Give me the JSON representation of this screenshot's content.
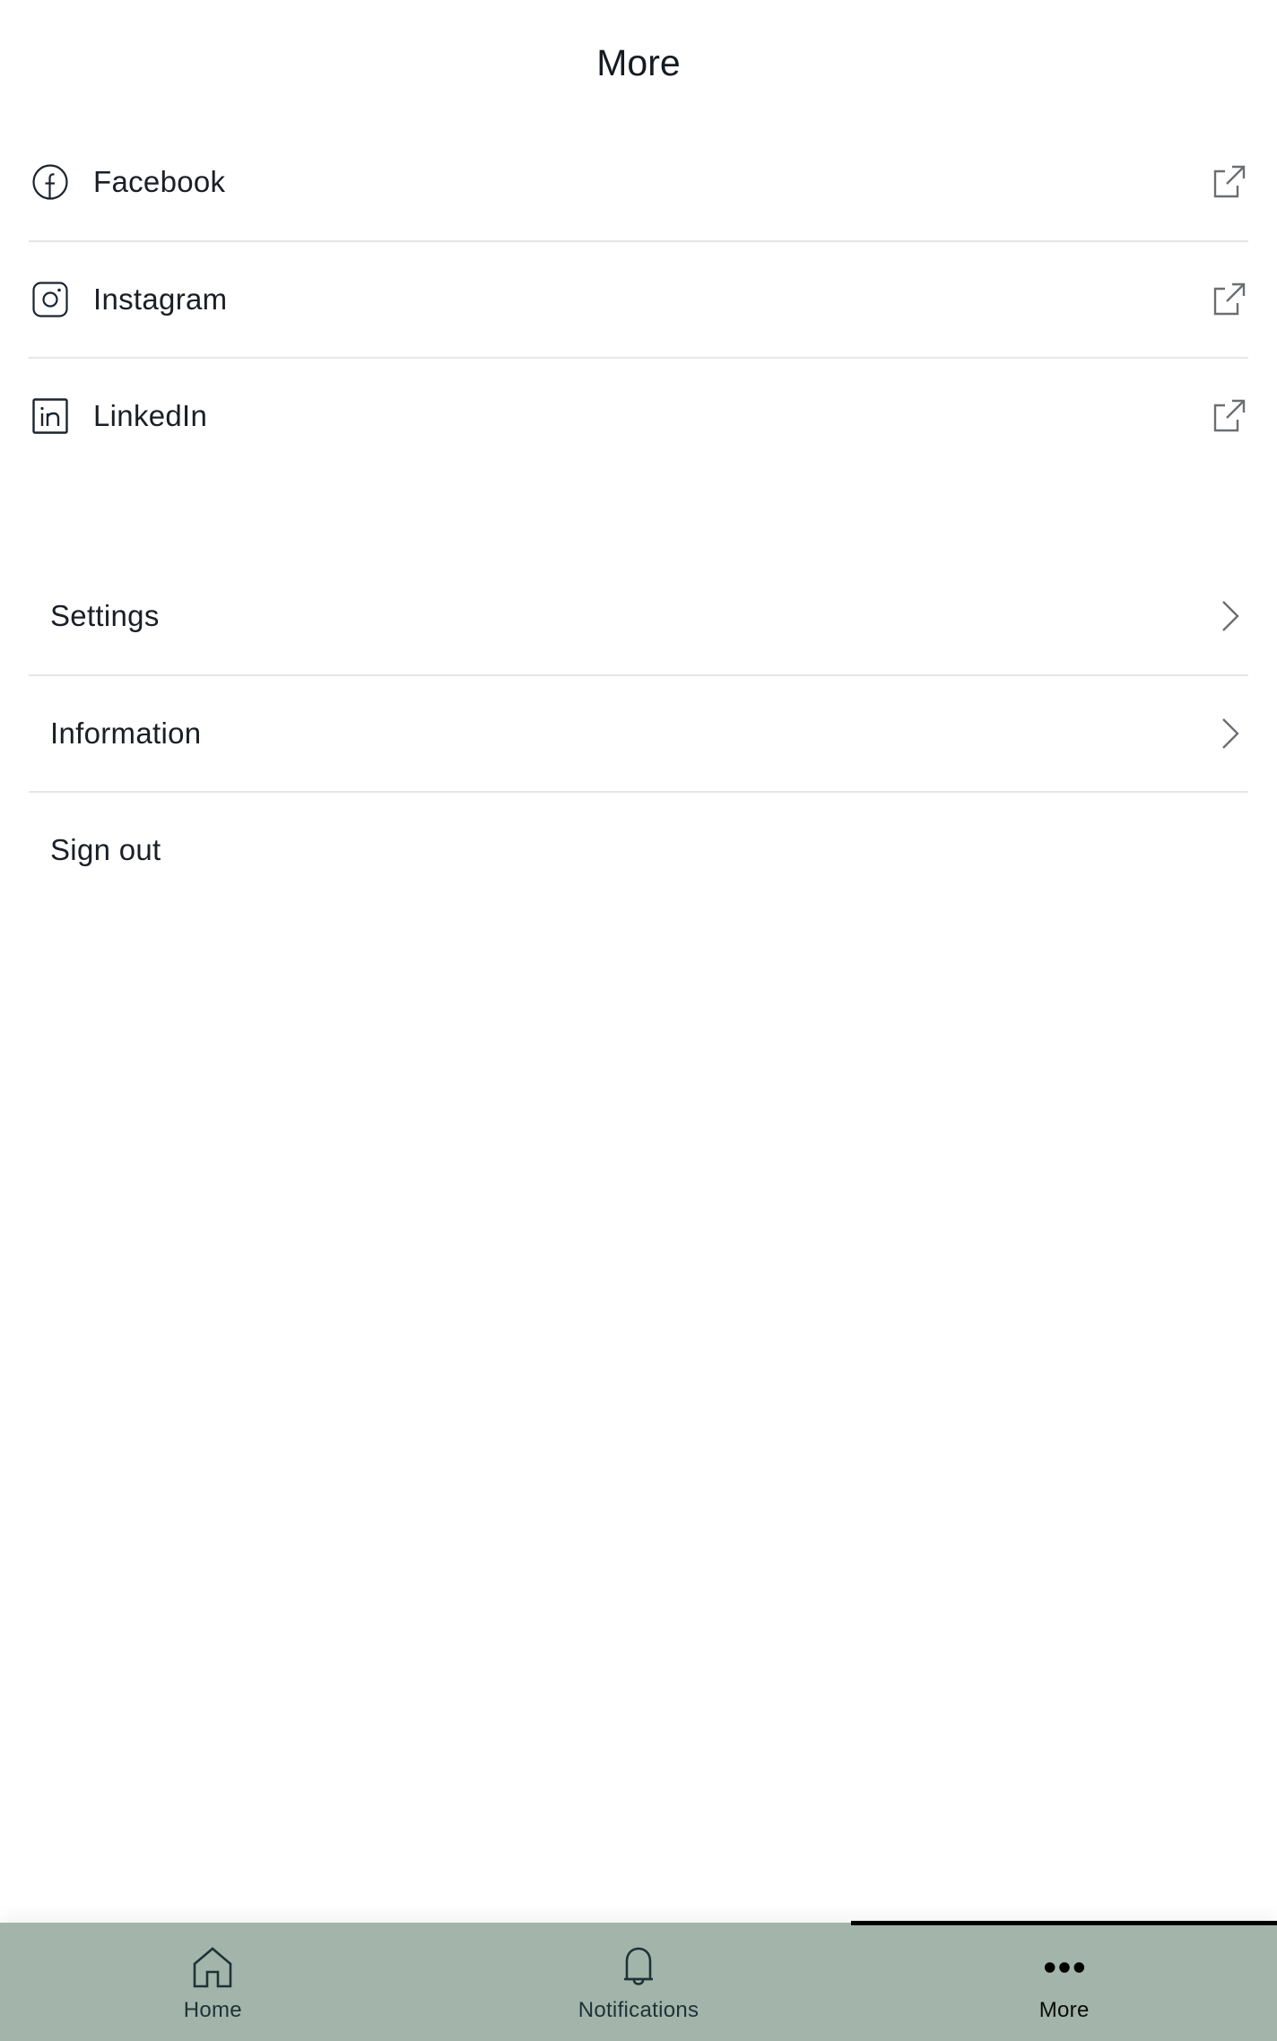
{
  "header": {
    "title": "More"
  },
  "social_links": [
    {
      "label": "Facebook",
      "icon": "facebook-icon",
      "action_icon": "external-link-icon"
    },
    {
      "label": "Instagram",
      "icon": "instagram-icon",
      "action_icon": "external-link-icon"
    },
    {
      "label": "LinkedIn",
      "icon": "linkedin-icon",
      "action_icon": "external-link-icon"
    }
  ],
  "menu": [
    {
      "label": "Settings",
      "action_icon": "chevron-right-icon"
    },
    {
      "label": "Information",
      "action_icon": "chevron-right-icon"
    },
    {
      "label": "Sign out"
    }
  ],
  "bottom_nav": {
    "items": [
      {
        "label": "Home",
        "icon": "home-icon",
        "active": false
      },
      {
        "label": "Notifications",
        "icon": "bell-icon",
        "active": false
      },
      {
        "label": "More",
        "icon": "more-dots-icon",
        "active": true
      }
    ]
  },
  "colors": {
    "nav_background": "#a3b5aa",
    "active_indicator": "#000000",
    "divider": "#e6e6e6",
    "text": "#1b1e26",
    "icon_muted": "#6b6e72"
  }
}
